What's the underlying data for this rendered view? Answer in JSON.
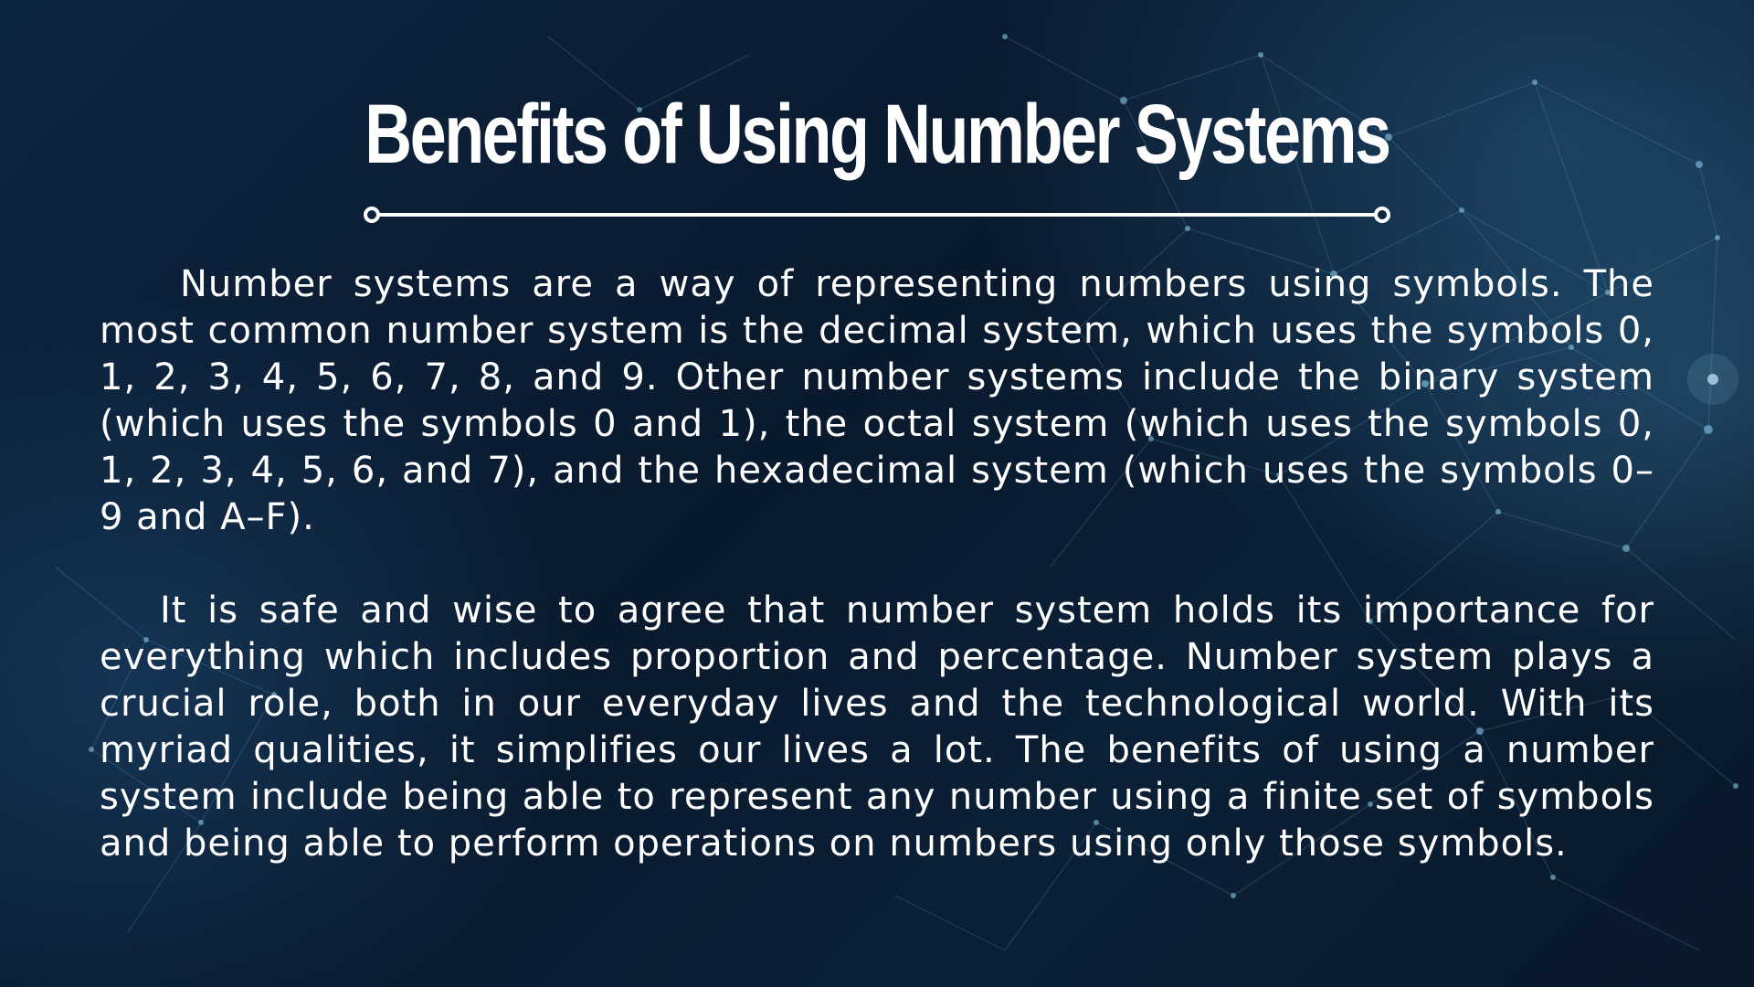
{
  "slide": {
    "title": "Benefits of Using Number Systems",
    "paragraphs": [
      "Number systems are a way of representing numbers using symbols. The most common number system is the decimal system, which uses the symbols 0, 1, 2, 3, 4, 5, 6, 7, 8, and 9. Other number systems include the binary system (which uses the symbols 0 and 1), the octal system (which uses the symbols 0, 1, 2, 3, 4, 5, 6, and 7), and the hexadecimal system (which uses the symbols 0–9 and A–F).",
      "It is safe and wise to agree that number system holds its importance for everything which includes proportion and percentage. Number system plays a crucial role, both in our everyday lives and the technological world. With its myriad qualities, it simplifies our lives a lot. The benefits of using a number system include being able to represent any number using a finite set of symbols and being able to perform operations on numbers using only those symbols."
    ]
  },
  "colors": {
    "background": "#0b1e33",
    "text": "#ffffff",
    "network": "#6fb3d9"
  }
}
